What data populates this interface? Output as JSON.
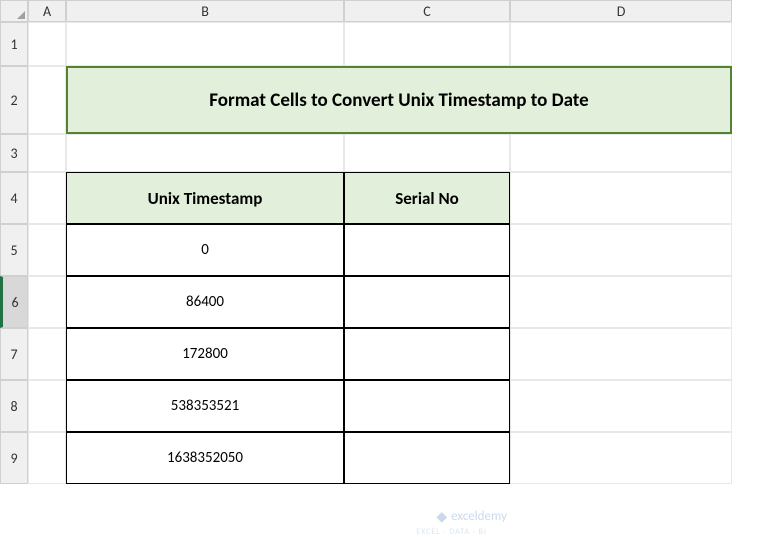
{
  "columns": [
    "A",
    "B",
    "C",
    "D"
  ],
  "rows": [
    "1",
    "2",
    "3",
    "4",
    "5",
    "6",
    "7",
    "8",
    "9"
  ],
  "selectedRow": "6",
  "title": "Format Cells to Convert Unix Timestamp to Date",
  "table": {
    "headers": {
      "timestamp": "Unix Timestamp",
      "serial": "Serial No"
    },
    "data": [
      {
        "timestamp": "0",
        "serial": ""
      },
      {
        "timestamp": "86400",
        "serial": ""
      },
      {
        "timestamp": "172800",
        "serial": ""
      },
      {
        "timestamp": "538353521",
        "serial": ""
      },
      {
        "timestamp": "1638352050",
        "serial": ""
      }
    ]
  },
  "watermark": {
    "text": "exceldemy",
    "sub": "EXCEL · DATA · BI"
  },
  "chart_data": {
    "type": "table",
    "title": "Format Cells to Convert Unix Timestamp to Date",
    "columns": [
      "Unix Timestamp",
      "Serial No"
    ],
    "rows": [
      [
        "0",
        ""
      ],
      [
        "86400",
        ""
      ],
      [
        "172800",
        ""
      ],
      [
        "538353521",
        ""
      ],
      [
        "1638352050",
        ""
      ]
    ]
  }
}
